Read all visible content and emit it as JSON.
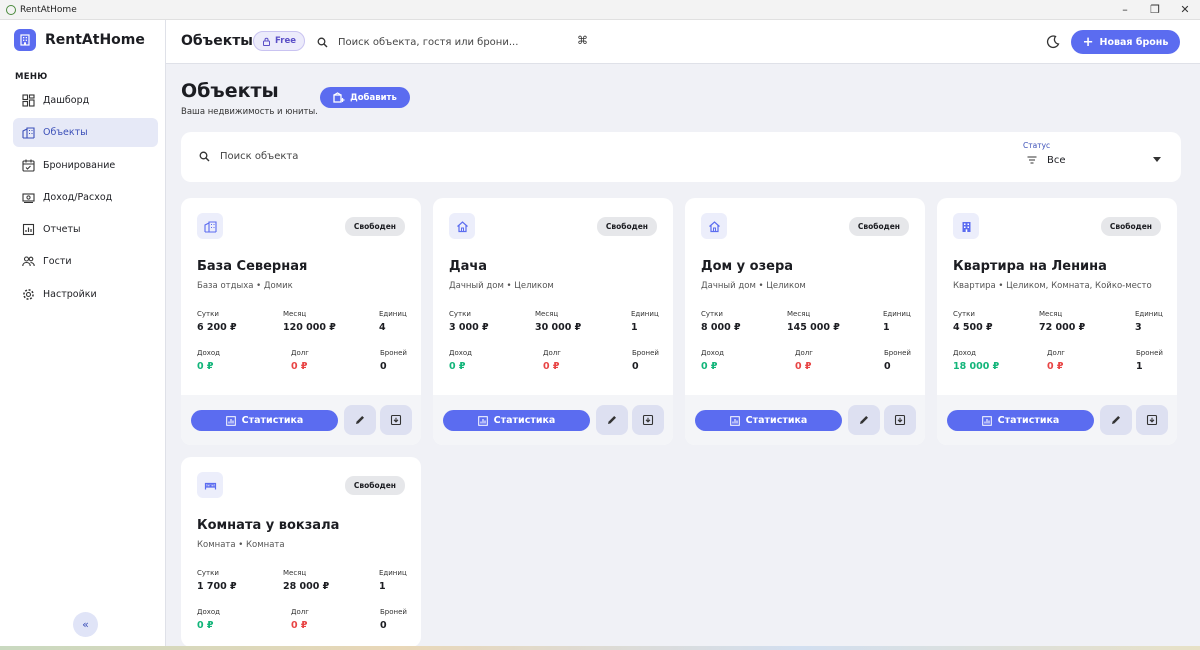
{
  "window": {
    "title": "RentAtHome"
  },
  "sidebar": {
    "brand": "RentAtHome",
    "menu_title": "МЕНЮ",
    "items": [
      {
        "label": "Дашборд",
        "icon": "dashboard-icon",
        "active": false
      },
      {
        "label": "Объекты",
        "icon": "building-icon",
        "active": true
      },
      {
        "label": "Бронирование",
        "icon": "calendar-icon",
        "active": false
      },
      {
        "label": "Доход/Расход",
        "icon": "cash-icon",
        "active": false
      },
      {
        "label": "Отчеты",
        "icon": "report-icon",
        "active": false
      },
      {
        "label": "Гости",
        "icon": "people-icon",
        "active": false
      },
      {
        "label": "Настройки",
        "icon": "gear-icon",
        "active": false
      }
    ],
    "collapse_glyph": "«"
  },
  "header": {
    "title": "Объекты",
    "badge": "Free",
    "search_placeholder": "Поиск объекта, гостя или брони...",
    "shortcut": "⌘",
    "new_booking": "Новая бронь"
  },
  "page": {
    "title": "Объекты",
    "subtitle": "Ваша недвижимость и юниты.",
    "add_label": "Добавить"
  },
  "filter": {
    "search_placeholder": "Поиск объекта",
    "status_label": "Статус",
    "status_value": "Все"
  },
  "labels": {
    "day": "Сутки",
    "month": "Месяц",
    "units": "Единиц",
    "income": "Доход",
    "debt": "Долг",
    "bookings": "Броней",
    "stats_button": "Статистика"
  },
  "colors": {
    "accent": "#5b6cf0",
    "income": "#13b57a",
    "debt": "#e84545"
  },
  "properties": [
    {
      "name": "База Северная",
      "type": "База отдыха • Домик",
      "status": "Свободен",
      "icon": "building-icon",
      "day": "6 200 ₽",
      "month": "120 000 ₽",
      "units": "4",
      "income": "0 ₽",
      "debt": "0 ₽",
      "bookings": "0"
    },
    {
      "name": "Дача",
      "type": "Дачный дом • Целиком",
      "status": "Свободен",
      "icon": "house-icon",
      "day": "3 000 ₽",
      "month": "30 000 ₽",
      "units": "1",
      "income": "0 ₽",
      "debt": "0 ₽",
      "bookings": "0"
    },
    {
      "name": "Дом у озера",
      "type": "Дачный дом • Целиком",
      "status": "Свободен",
      "icon": "house-icon",
      "day": "8 000 ₽",
      "month": "145 000 ₽",
      "units": "1",
      "income": "0 ₽",
      "debt": "0 ₽",
      "bookings": "0"
    },
    {
      "name": "Квартира на Ленина",
      "type": "Квартира • Целиком, Комната, Койко-место",
      "status": "Свободен",
      "icon": "apartment-icon",
      "day": "4 500 ₽",
      "month": "72 000 ₽",
      "units": "3",
      "income": "18 000 ₽",
      "debt": "0 ₽",
      "bookings": "1"
    },
    {
      "name": "Комната у вокзала",
      "type": "Комната • Комната",
      "status": "Свободен",
      "icon": "bed-icon",
      "day": "1 700 ₽",
      "month": "28 000 ₽",
      "units": "1",
      "income": "0 ₽",
      "debt": "0 ₽",
      "bookings": "0"
    }
  ]
}
